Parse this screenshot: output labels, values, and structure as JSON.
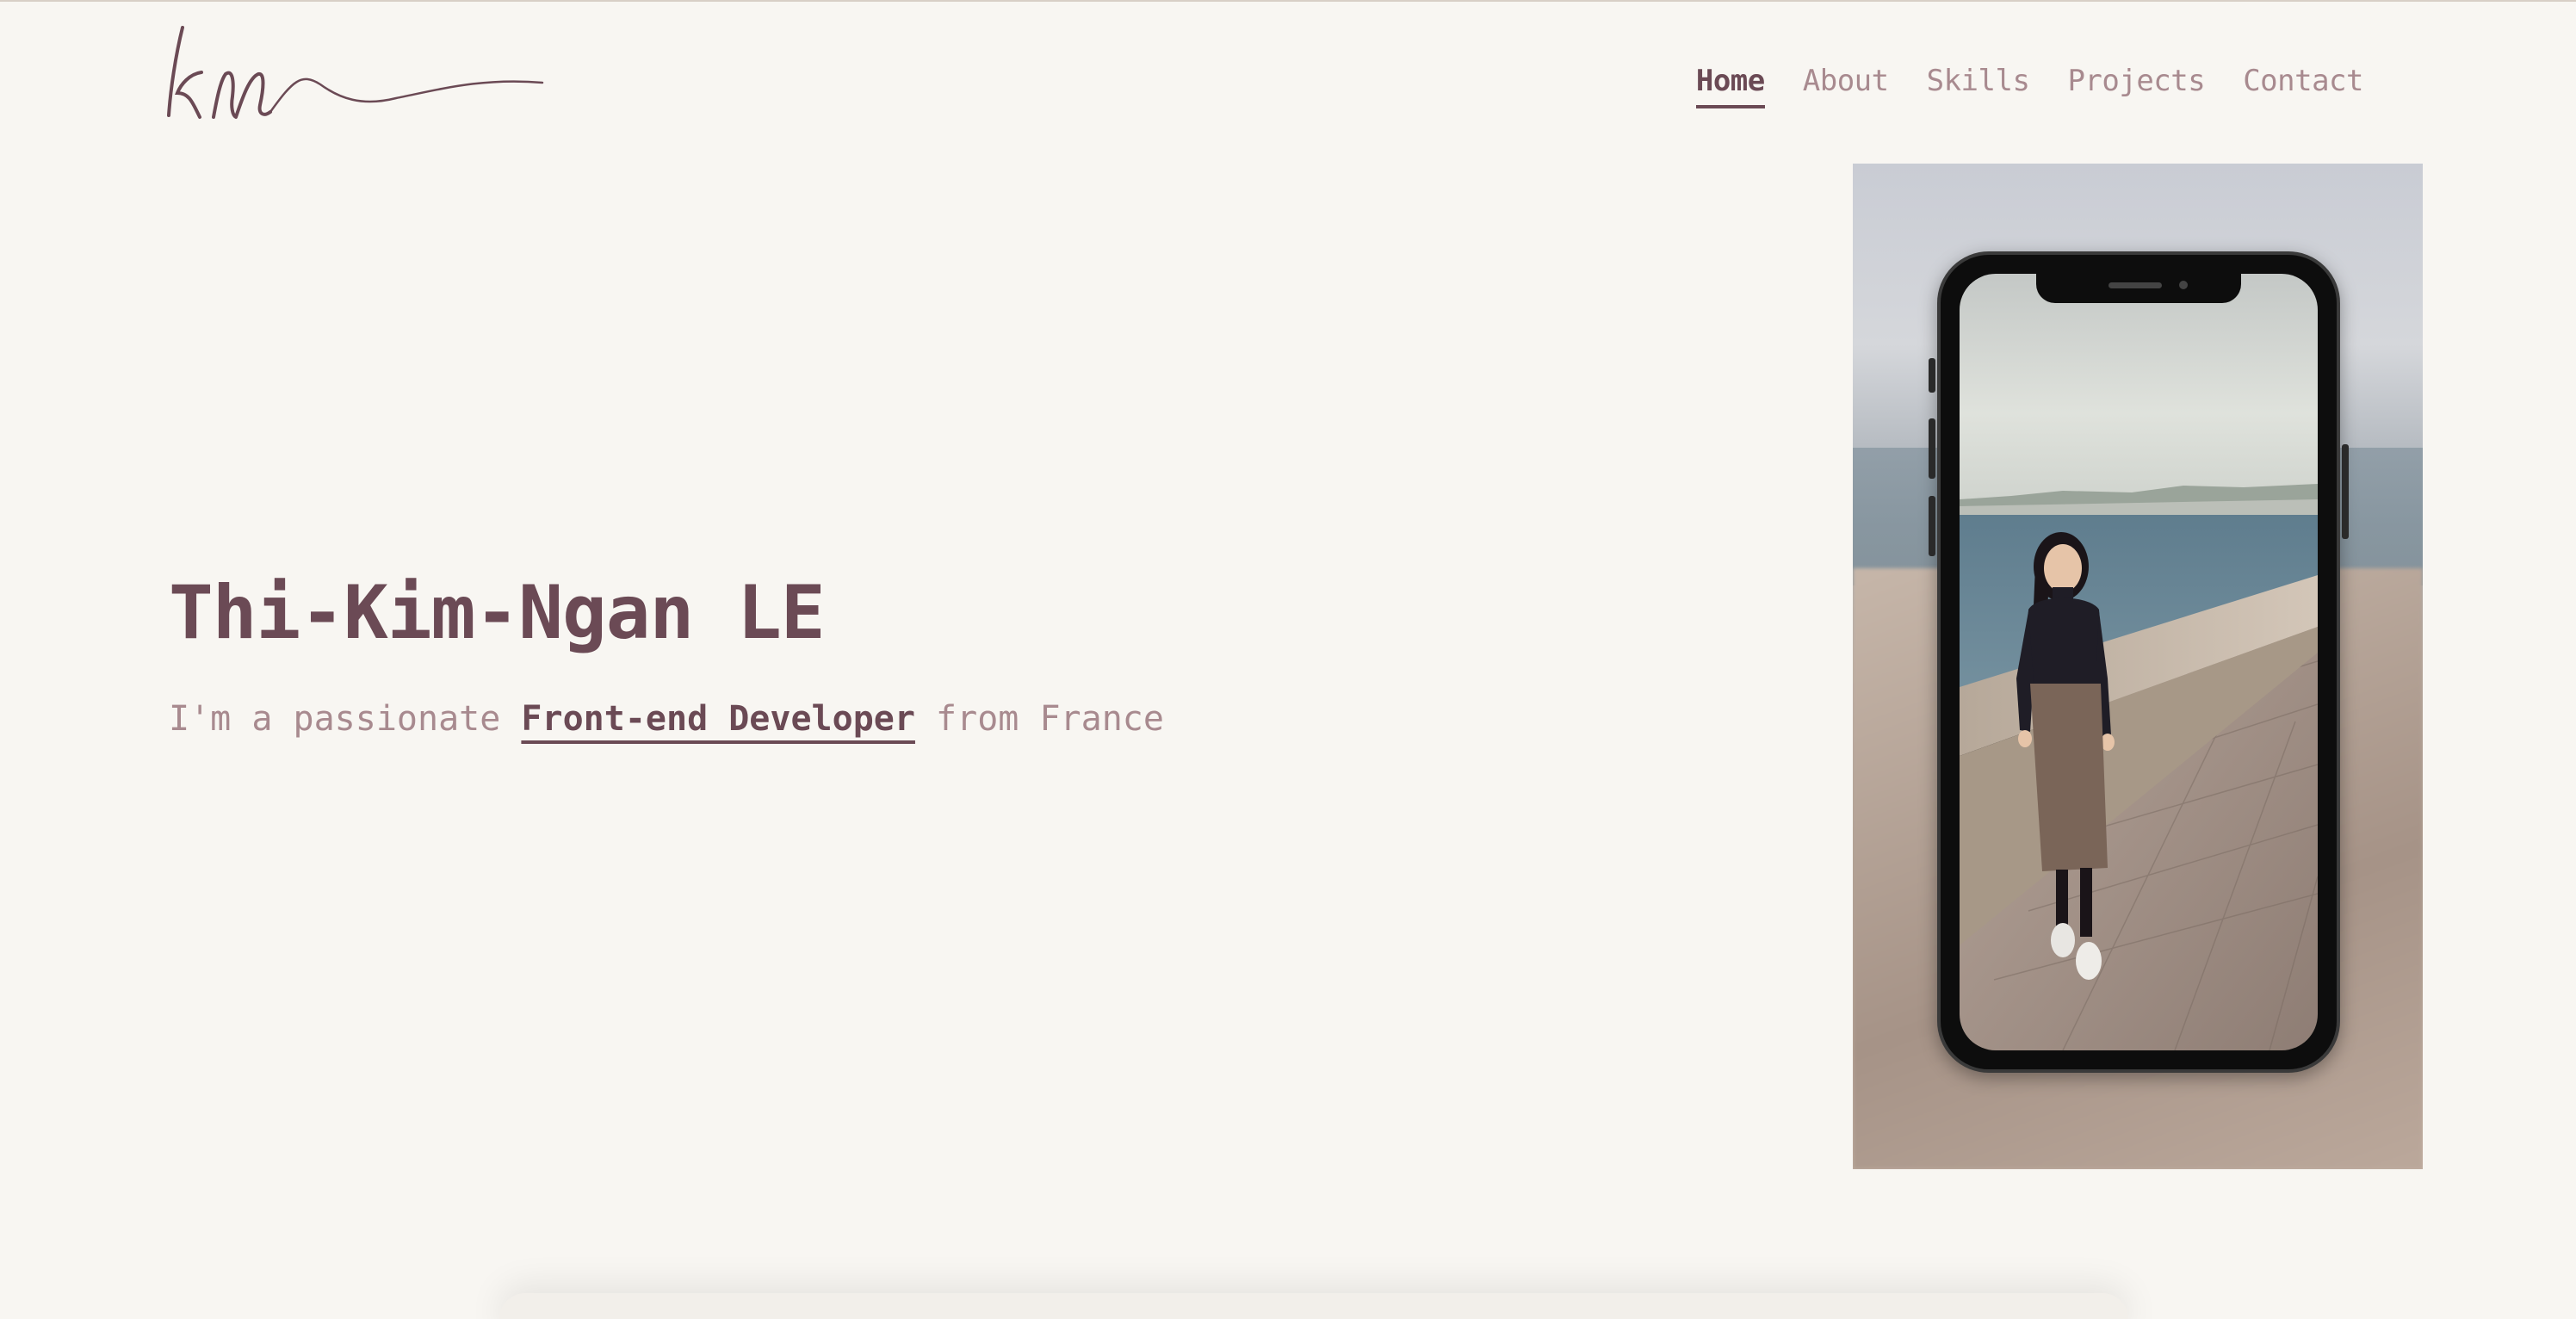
{
  "logo": {
    "text": "kn"
  },
  "nav": {
    "items": [
      {
        "label": "Home",
        "active": true
      },
      {
        "label": "About",
        "active": false
      },
      {
        "label": "Skills",
        "active": false
      },
      {
        "label": "Projects",
        "active": false
      },
      {
        "label": "Contact",
        "active": false
      }
    ]
  },
  "hero": {
    "name": "Thi-Kim-Ngan LE",
    "subtitle_prefix": "I'm a passionate ",
    "subtitle_role": "Front-end Developer",
    "subtitle_suffix": " from France"
  },
  "colors": {
    "background": "#f8f6f2",
    "primary": "#6b4a55",
    "muted": "#a88a8f"
  },
  "icons": {
    "logo": "signature-logo-icon",
    "phone": "smartphone-mockup-icon"
  }
}
